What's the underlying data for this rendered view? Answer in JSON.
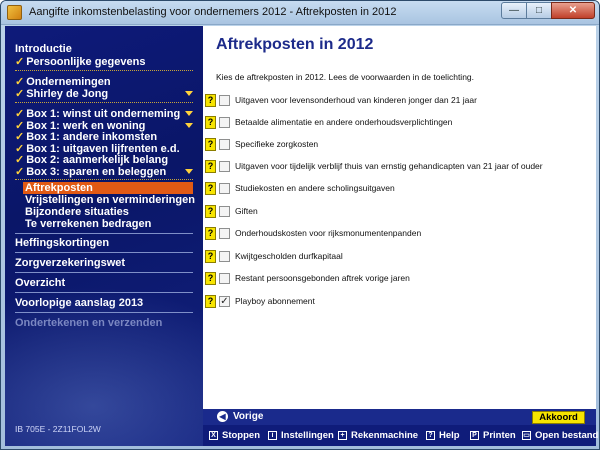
{
  "window": {
    "title": "Aangifte inkomstenbelasting voor ondernemers 2012 - Aftrekposten in 2012",
    "controls": {
      "minimize": "—",
      "maximize": "□",
      "close": "✕"
    }
  },
  "sidebar": {
    "intro": "Introductie",
    "personal": "Persoonlijke gegevens",
    "ondernemingen": "Ondernemingen",
    "person": "Shirley de Jong",
    "box1_winst": "Box 1: winst uit onderneming",
    "box1_werk": "Box 1: werk en woning",
    "box1_andere": "Box 1: andere inkomsten",
    "box1_uitgaven": "Box 1: uitgaven lijfrenten e.d.",
    "box2": "Box 2: aanmerkelijk belang",
    "box3": "Box 3: sparen en beleggen",
    "aftrekposten": "Aftrekposten",
    "vrijstellingen": "Vrijstellingen en verminderingen",
    "bijzondere": "Bijzondere situaties",
    "verrekenen": "Te verrekenen bedragen",
    "heffingskortingen": "Heffingskortingen",
    "zorgverzekeringswet": "Zorgverzekeringswet",
    "overzicht": "Overzicht",
    "voorlopige": "Voorlopige aanslag 2013",
    "ondertekenen": "Ondertekenen en verzenden",
    "footer_code": "IB 705E - 2Z11FOL2W",
    "checkmark": "✓"
  },
  "main": {
    "title": "Aftrekposten in 2012",
    "intro": "Kies de aftrekposten in 2012. Lees de voorwaarden in de toelichting.",
    "help_glyph": "?",
    "items": [
      {
        "label": "Uitgaven voor levensonderhoud van kinderen jonger dan 21 jaar",
        "checked": false,
        "mark": ""
      },
      {
        "label": "Betaalde alimentatie en andere onderhoudsverplichtingen",
        "checked": false,
        "mark": ""
      },
      {
        "label": "Specifieke zorgkosten",
        "checked": false,
        "mark": ""
      },
      {
        "label": "Uitgaven voor tijdelijk verblijf thuis van ernstig gehandicapten van 21 jaar of ouder",
        "checked": false,
        "mark": ""
      },
      {
        "label": "Studiekosten en andere scholingsuitgaven",
        "checked": false,
        "mark": ""
      },
      {
        "label": "Giften",
        "checked": false,
        "mark": ""
      },
      {
        "label": "Onderhoudskosten voor rijksmonumentenpanden",
        "checked": false,
        "mark": ""
      },
      {
        "label": "Kwijtgescholden durfkapitaal",
        "checked": false,
        "mark": ""
      },
      {
        "label": "Restant persoonsgebonden aftrek vorige jaren",
        "checked": false,
        "mark": ""
      },
      {
        "label": "Playboy abonnement",
        "checked": true,
        "mark": "✓"
      }
    ]
  },
  "nav": {
    "prev_label": "Vorige",
    "prev_icon": "◀",
    "ok_label": "Akkoord"
  },
  "toolbar": {
    "stop": "Stoppen",
    "stop_icon": "X",
    "settings": "Instellingen",
    "settings_icon": "i",
    "calculator": "Rekenmachine",
    "calculator_icon": "+",
    "help": "Help",
    "help_icon": "?",
    "print": "Printen",
    "print_icon": "P",
    "open": "Open bestand",
    "open_icon": "▭"
  },
  "colors": {
    "sidebar_bg": "#0e1a7a",
    "active": "#e25a14",
    "accent_yellow": "#f7e400",
    "title_blue": "#1c2a8a"
  }
}
